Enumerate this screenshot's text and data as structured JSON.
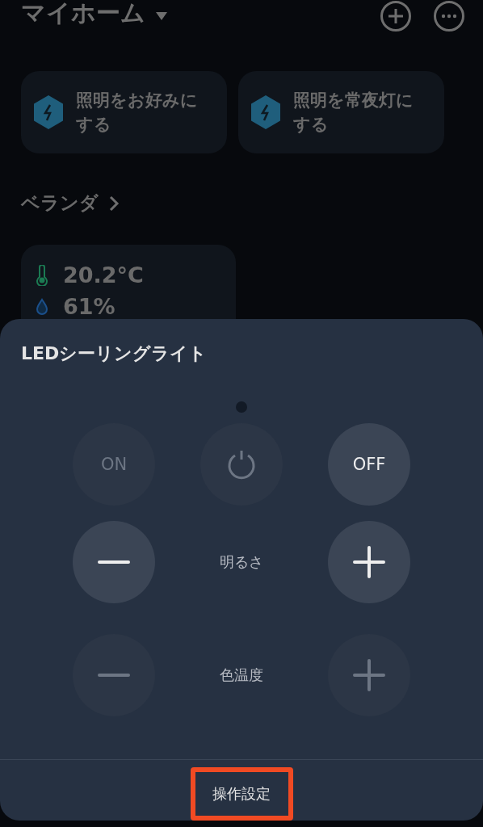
{
  "header": {
    "title": "マイホーム"
  },
  "scenes": [
    {
      "label": "照明をお好みにする"
    },
    {
      "label": "照明を常夜灯にする"
    }
  ],
  "room": {
    "name": "ベランダ"
  },
  "sensor": {
    "temperature": "20.2°C",
    "humidity": "61%"
  },
  "sheet": {
    "title": "LEDシーリングライト",
    "rows": [
      {
        "label": "",
        "buttons": [
          {
            "kind": "text",
            "text": "ON",
            "disabled": true
          },
          {
            "kind": "power",
            "disabled": true
          },
          {
            "kind": "text",
            "text": "OFF",
            "disabled": false
          }
        ]
      },
      {
        "label": "明るさ",
        "buttons": [
          {
            "kind": "minus",
            "disabled": false
          },
          {
            "kind": "plus",
            "disabled": false
          }
        ]
      },
      {
        "label": "色温度",
        "buttons": [
          {
            "kind": "minus",
            "disabled": true
          },
          {
            "kind": "plus",
            "disabled": true
          }
        ]
      }
    ],
    "footer": {
      "label": "操作設定",
      "highlighted": true
    }
  }
}
